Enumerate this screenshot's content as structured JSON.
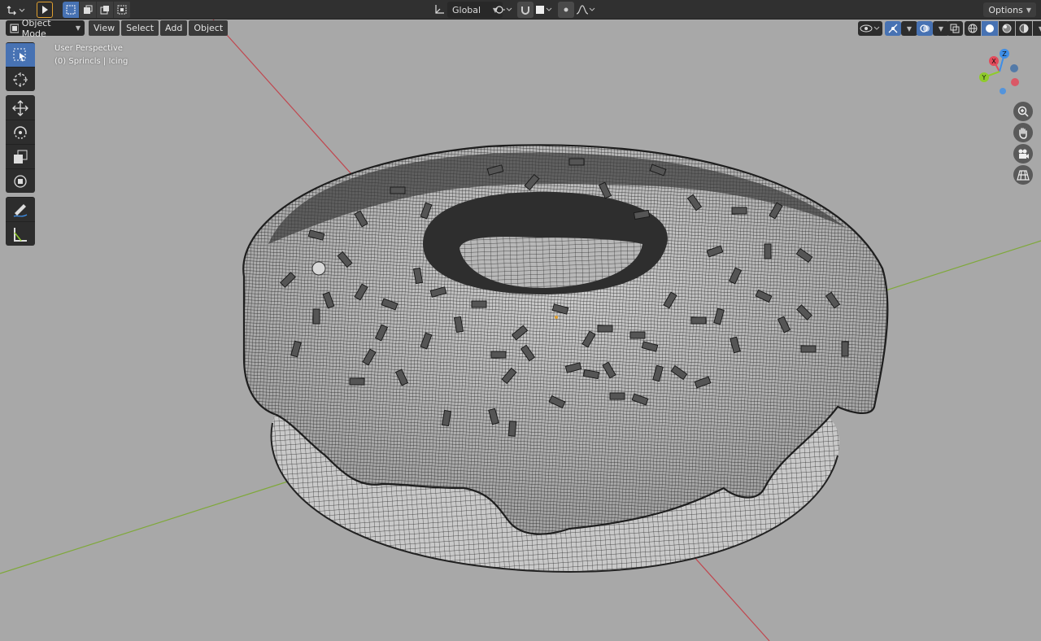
{
  "header": {
    "transform_orientation": "Global",
    "options_label": "Options"
  },
  "mode": {
    "label": "Object Mode"
  },
  "menus": [
    "View",
    "Select",
    "Add",
    "Object"
  ],
  "viewport": {
    "perspective_label": "User Perspective",
    "object_label": "(0) Sprincls | Icing"
  },
  "gizmo": {
    "x": "X",
    "y": "Y",
    "z": "Z"
  },
  "colors": {
    "active_blue": "#4772b3",
    "viewport_bg": "#a8a8a8",
    "axis_x": "#e34a5a",
    "axis_y": "#8fcb2c",
    "axis_z": "#3d8ee8"
  },
  "tools": [
    "select-box-icon",
    "cursor-icon",
    "move-icon",
    "rotate-icon",
    "scale-icon",
    "transform-icon",
    "annotate-icon",
    "measure-icon"
  ]
}
